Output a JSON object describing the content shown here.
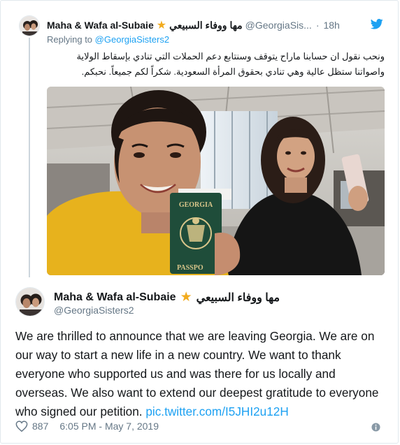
{
  "reply_tweet": {
    "display_name": "Maha & Wafa al-Subaie",
    "verified_star": "★",
    "display_name_ar": "مها ووفاء السبيعي",
    "handle": "@GeorgiaSis...",
    "separator": "·",
    "time": "18h",
    "replying_prefix": "Replying to",
    "replying_to": "@GeorgiaSisters2",
    "text_line1": "ونحب نقول ان حسابنا ماراح يتوقف وسنتابع دعم الحملات التي تنادي بإسقاط الولاية",
    "text_line2": "واصواتنا ستظل عالية وهي تنادي بحقوق المرأة السعودية. شكراً لكم جميعاً. نحبكم.",
    "passport_title": "GEORGIA",
    "passport_label": "PASSPO"
  },
  "main_tweet": {
    "display_name": "Maha & Wafa al-Subaie",
    "verified_star": "★",
    "display_name_ar": "مها ووفاء السبيعي",
    "handle": "@GeorgiaSisters2",
    "text": "We are thrilled to announce that we are leaving Georgia. We are on our way to start a new life in a new country. We want to thank everyone who supported us and was there for us locally and overseas. We also want to extend our deepest gratitude to everyone who signed our petition.",
    "link": "pic.twitter.com/I5JHI2u12H",
    "likes": "887",
    "timestamp": "6:05 PM - May 7, 2019"
  },
  "icons": {
    "bird": "twitter-bird-icon",
    "heart": "heart-icon",
    "info": "info-icon",
    "star": "verified-star"
  },
  "colors": {
    "twitter_blue": "#1da1f2",
    "muted_text": "#657786",
    "star_gold": "#f2ab1e",
    "text": "#14171a"
  }
}
